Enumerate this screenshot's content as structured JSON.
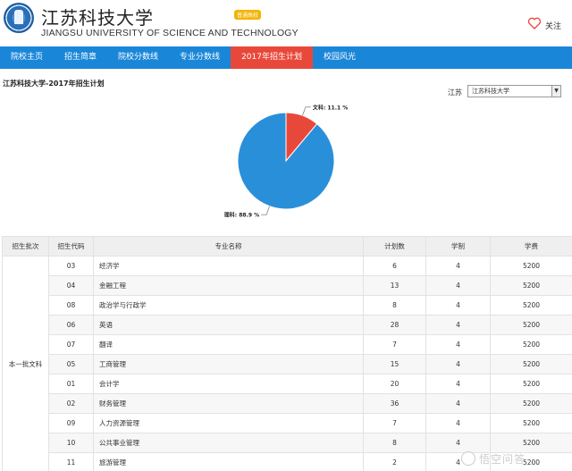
{
  "header": {
    "name_cn": "江苏科技大学",
    "name_en": "JIANGSU UNIVERSITY OF SCIENCE AND TECHNOLOGY",
    "badge": "普通高校",
    "follow_label": "关注"
  },
  "nav": {
    "items": [
      {
        "label": "院校主页",
        "active": false
      },
      {
        "label": "招生简章",
        "active": false
      },
      {
        "label": "院校分数线",
        "active": false
      },
      {
        "label": "专业分数线",
        "active": false
      },
      {
        "label": "2017年招生计划",
        "active": true
      },
      {
        "label": "校园风光",
        "active": false
      }
    ]
  },
  "plan": {
    "title": "江苏科技大学-2017年招生计划",
    "province_label": "江苏",
    "select_value": "江苏科技大学"
  },
  "chart_data": {
    "type": "pie",
    "title": "",
    "slices": [
      {
        "label": "文科",
        "value": 11.1,
        "pct_label": "11.1 %",
        "color": "#e8483a"
      },
      {
        "label": "理科",
        "value": 88.9,
        "pct_label": "88.9 %",
        "color": "#2a8fd9"
      }
    ]
  },
  "table": {
    "headers": [
      "招生批次",
      "招生代码",
      "专业名称",
      "计划数",
      "学制",
      "学费"
    ],
    "batch": "本一批文科",
    "rows": [
      {
        "code": "03",
        "name": "经济学",
        "plan": "6",
        "years": "4",
        "fee": "5200"
      },
      {
        "code": "04",
        "name": "金融工程",
        "plan": "13",
        "years": "4",
        "fee": "5200"
      },
      {
        "code": "08",
        "name": "政治学与行政学",
        "plan": "8",
        "years": "4",
        "fee": "5200"
      },
      {
        "code": "06",
        "name": "英语",
        "plan": "28",
        "years": "4",
        "fee": "5200"
      },
      {
        "code": "07",
        "name": "翻译",
        "plan": "7",
        "years": "4",
        "fee": "5200"
      },
      {
        "code": "05",
        "name": "工商管理",
        "plan": "15",
        "years": "4",
        "fee": "5200"
      },
      {
        "code": "01",
        "name": "会计学",
        "plan": "20",
        "years": "4",
        "fee": "5200"
      },
      {
        "code": "02",
        "name": "财务管理",
        "plan": "36",
        "years": "4",
        "fee": "5200"
      },
      {
        "code": "09",
        "name": "人力资源管理",
        "plan": "7",
        "years": "4",
        "fee": "5200"
      },
      {
        "code": "10",
        "name": "公共事业管理",
        "plan": "8",
        "years": "4",
        "fee": "5200"
      },
      {
        "code": "11",
        "name": "旅游管理",
        "plan": "2",
        "years": "4",
        "fee": "5200"
      }
    ]
  },
  "watermark": {
    "text": "悟空问答"
  },
  "colors": {
    "nav_bg": "#1a86d8",
    "nav_active": "#e8483a",
    "badge": "#f5b400"
  }
}
